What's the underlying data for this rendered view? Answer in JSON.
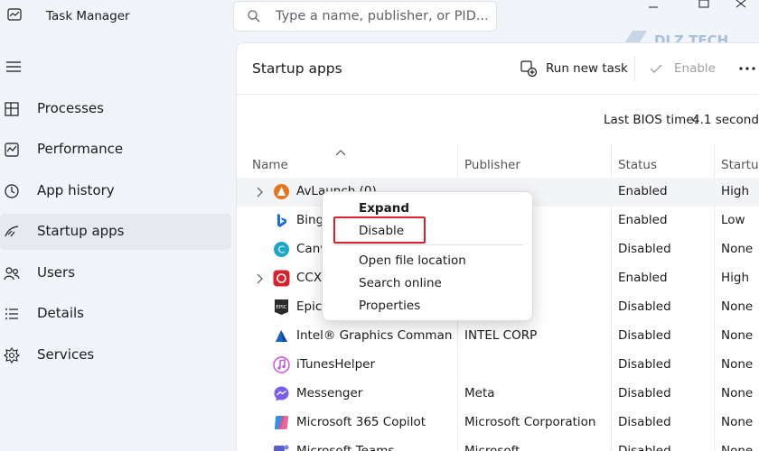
{
  "app": {
    "title": "Task Manager"
  },
  "search": {
    "placeholder": "Type a name, publisher, or PID..."
  },
  "sidebar": {
    "items": [
      {
        "label": "Processes",
        "icon": "processes-icon"
      },
      {
        "label": "Performance",
        "icon": "performance-icon"
      },
      {
        "label": "App history",
        "icon": "app-history-icon"
      },
      {
        "label": "Startup apps",
        "icon": "startup-apps-icon",
        "active": true
      },
      {
        "label": "Users",
        "icon": "users-icon"
      },
      {
        "label": "Details",
        "icon": "details-icon"
      },
      {
        "label": "Services",
        "icon": "services-icon"
      }
    ]
  },
  "page": {
    "title": "Startup apps",
    "run_new_task": "Run new task",
    "enable": "Enable",
    "bios_label": "Last BIOS time:",
    "bios_value": "4.1 seconds"
  },
  "columns": {
    "name": "Name",
    "publisher": "Publisher",
    "status": "Status",
    "impact": "Startup"
  },
  "rows": [
    {
      "name": "AvLaunch (0)",
      "publisher": "",
      "status": "Enabled",
      "impact": "High",
      "expandable": true,
      "icon_color": "#e8741f"
    },
    {
      "name": "Bing",
      "publisher": "",
      "status": "Enabled",
      "impact": "Low",
      "expandable": false,
      "icon_color": "#1f6ed4"
    },
    {
      "name": "Canva",
      "publisher": "d",
      "status": "Disabled",
      "impact": "None",
      "expandable": false,
      "icon_color": "#1fa6c4"
    },
    {
      "name": "CCX",
      "publisher": "",
      "status": "Enabled",
      "impact": "High",
      "expandable": true,
      "icon_color": "#d4232e"
    },
    {
      "name": "Epic",
      "publisher": "",
      "status": "Disabled",
      "impact": "None",
      "expandable": false,
      "icon_color": "#2b2b2b"
    },
    {
      "name": "Intel® Graphics Comman...",
      "publisher": "INTEL CORP",
      "status": "Disabled",
      "impact": "None",
      "expandable": false,
      "icon_color": "#1565c0"
    },
    {
      "name": "iTunesHelper",
      "publisher": "",
      "status": "Disabled",
      "impact": "None",
      "expandable": false,
      "icon_color": "#c24fd6"
    },
    {
      "name": "Messenger",
      "publisher": "Meta",
      "status": "Disabled",
      "impact": "None",
      "expandable": false,
      "icon_color": "#7b5cf0"
    },
    {
      "name": "Microsoft 365 Copilot",
      "publisher": "Microsoft Corporation",
      "status": "Disabled",
      "impact": "None",
      "expandable": false,
      "icon_color": "#3a8ee6"
    },
    {
      "name": "Microsoft Teams",
      "publisher": "Microsoft",
      "status": "Disabled",
      "impact": "None",
      "expandable": false,
      "icon_color": "#5b5fc7"
    }
  ],
  "context_menu": {
    "items": [
      "Expand",
      "Disable",
      "Open file location",
      "Search online",
      "Properties"
    ]
  },
  "watermark": {
    "text": "DLZ TECH"
  },
  "colors": {
    "highlight": "#d9222e",
    "accent": "#1f6ed4"
  }
}
